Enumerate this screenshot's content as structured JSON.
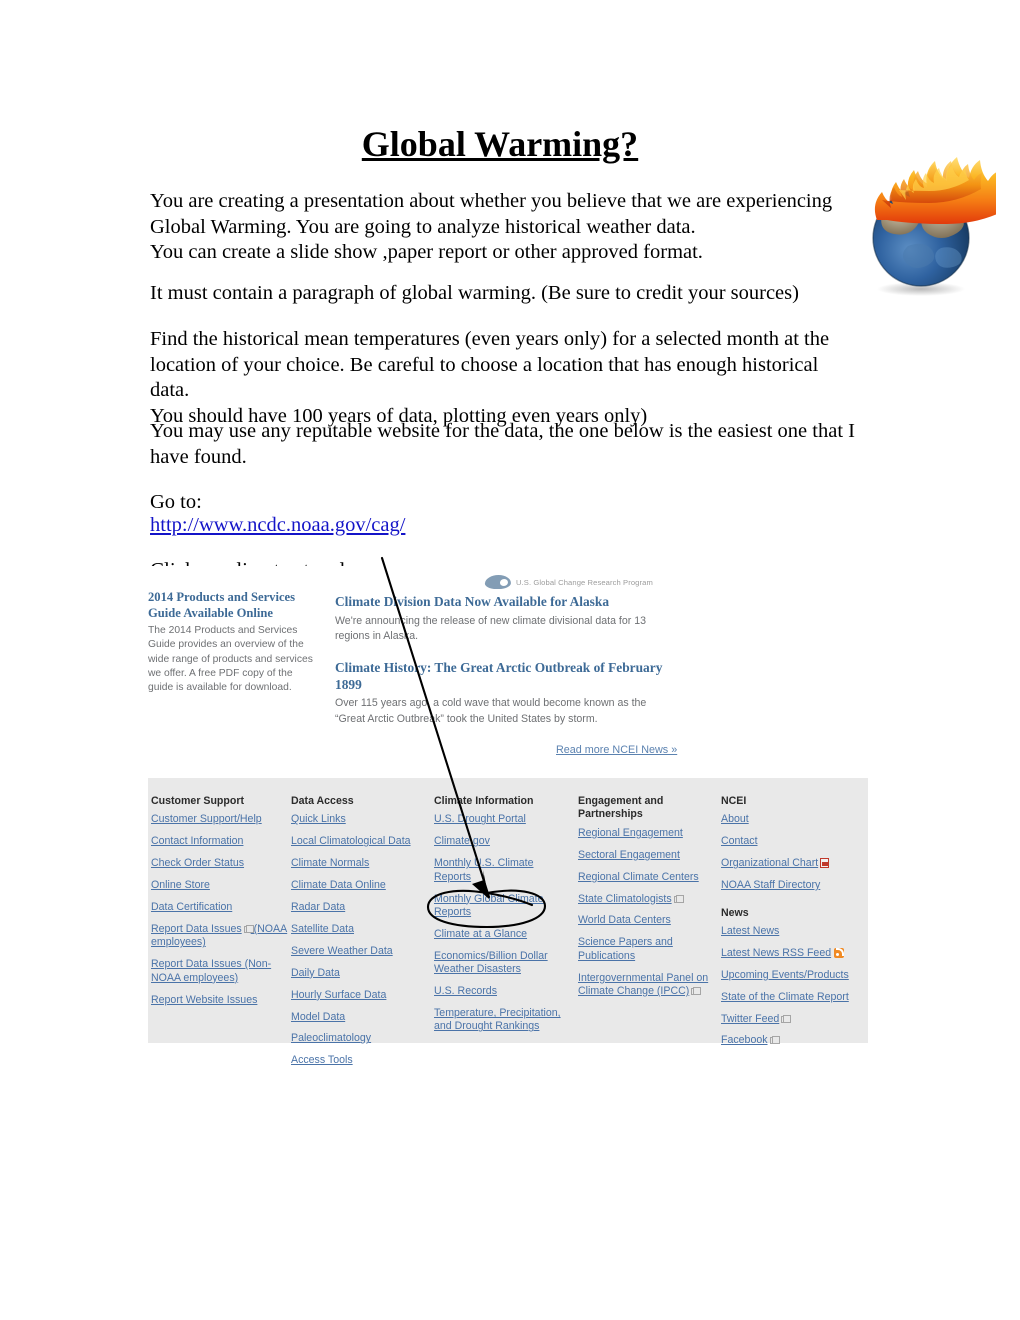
{
  "document": {
    "title": "Global Warming?",
    "paragraphs": {
      "p1": "You are creating a presentation about whether you believe that we are experiencing\nGlobal Warming.  You are going to analyze historical weather data.\nYou can create a slide show ,paper report or other approved format.",
      "p2": "It must contain a paragraph of global warming.  (Be sure to credit your sources)",
      "p3": "Find the historical mean temperatures (even years only)  for a selected month at the\nlocation of your choice.  Be careful to choose a location that has enough historical data.\nYou should have 100 years of data, plotting even years only)",
      "p4": "You may use any reputable website for the data, the one below is the easiest one that I\nhave found.",
      "p5": "Go to:",
      "p6": "Click on climate at a glance"
    },
    "link": {
      "text": "http://www.ncdc.noaa.gov/cag/",
      "color": "#1414c8"
    },
    "image_alt": "burning-earth-globe"
  },
  "screenshot": {
    "partner_logo": "U.S. Global Change Research Program",
    "news_left": {
      "heading": "2014 Products and Services Guide Available Online",
      "body": "The 2014 Products and Services Guide provides an overview of the wide range of products and services we offer. A free PDF copy of the guide is available for download."
    },
    "news_items": [
      {
        "heading": "Climate Division Data Now Available for Alaska",
        "body": "We're announcing the release of new climate divisional data for 13 regions in Alaska."
      },
      {
        "heading": "Climate History: The Great Arctic Outbreak of February 1899",
        "body": "Over 115 years ago, a cold wave that would become known as the “Great Arctic Outbreak” took the United States by storm."
      }
    ],
    "read_more": "Read more NCEI News »",
    "footer_columns": [
      {
        "heading": "Customer Support",
        "links": [
          {
            "label": "Customer Support/Help"
          },
          {
            "label": "Contact Information"
          },
          {
            "label": "Check Order Status"
          },
          {
            "label": "Online Store"
          },
          {
            "label": "Data Certification"
          },
          {
            "label": "Report Data Issues",
            "suffix": " (NOAA employees)",
            "external": true
          },
          {
            "label": "Report Data Issues (Non-NOAA employees)"
          },
          {
            "label": "Report Website Issues"
          }
        ]
      },
      {
        "heading": "Data Access",
        "links": [
          {
            "label": "Quick Links"
          },
          {
            "label": "Local Climatological Data"
          },
          {
            "label": "Climate Normals"
          },
          {
            "label": "Climate Data Online"
          },
          {
            "label": "Radar Data"
          },
          {
            "label": "Satellite Data"
          },
          {
            "label": "Severe Weather Data"
          },
          {
            "label": "Daily Data"
          },
          {
            "label": "Hourly Surface Data"
          },
          {
            "label": "Model Data"
          },
          {
            "label": "Paleoclimatology"
          },
          {
            "label": "Access Tools"
          }
        ]
      },
      {
        "heading": "Climate Information",
        "links": [
          {
            "label": "U.S. Drought Portal"
          },
          {
            "label": "Climate.gov"
          },
          {
            "label": "Monthly U.S. Climate Reports"
          },
          {
            "label": "Monthly Global Climate Reports"
          },
          {
            "label": "Climate at a Glance",
            "highlighted": true
          },
          {
            "label": "Economics/Billion Dollar Weather Disasters"
          },
          {
            "label": "U.S. Records"
          },
          {
            "label": "Temperature, Precipitation, and Drought Rankings"
          }
        ]
      },
      {
        "heading": "Engagement and Partnerships",
        "links": [
          {
            "label": "Regional Engagement"
          },
          {
            "label": "Sectoral Engagement"
          },
          {
            "label": "Regional Climate Centers"
          },
          {
            "label": "State Climatologists",
            "external": true
          },
          {
            "label": "World Data Centers"
          },
          {
            "label": "Science Papers and Publications"
          },
          {
            "label": "Intergovernmental Panel on Climate Change (IPCC)",
            "external": true
          }
        ]
      },
      {
        "heading": "NCEI",
        "links": [
          {
            "label": "About"
          },
          {
            "label": "Contact"
          },
          {
            "label": "Organizational Chart",
            "pdf": true
          },
          {
            "label": "NOAA Staff Directory"
          }
        ],
        "subheading": "News",
        "sublinks": [
          {
            "label": "Latest News"
          },
          {
            "label": "Latest News RSS Feed",
            "rss": true
          },
          {
            "label": "Upcoming Events/Products"
          },
          {
            "label": "State of the Climate Report"
          },
          {
            "label": "Twitter Feed",
            "external": true
          },
          {
            "label": "Facebook",
            "external": true
          }
        ]
      }
    ]
  },
  "annotation": {
    "arrow_label": "hand-drawn-arrow-to-climate-at-a-glance",
    "oval_label": "hand-drawn-oval-highlight"
  }
}
